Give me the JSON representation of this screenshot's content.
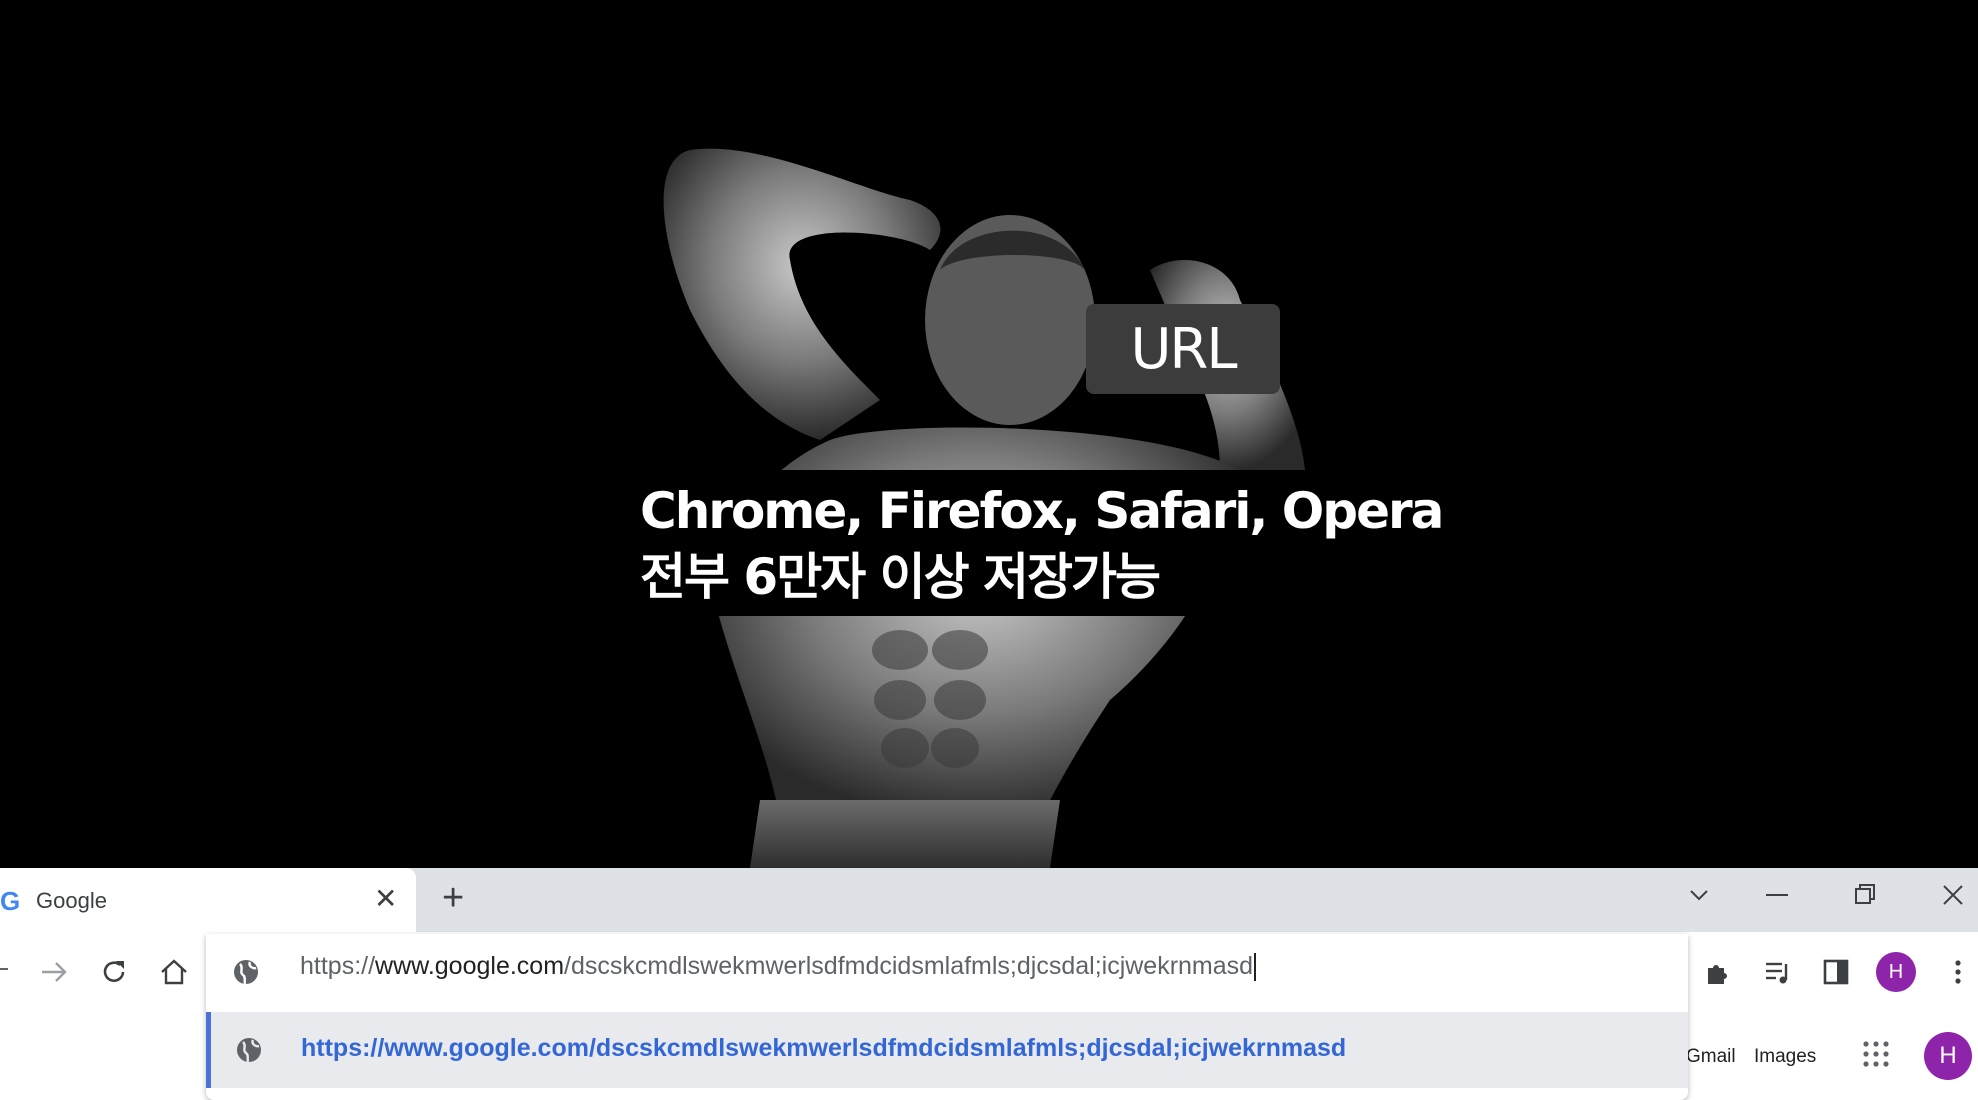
{
  "overlay": {
    "tag": "URL",
    "caption_lines": [
      "Chrome, Firefox, Safari, Opera",
      "전부 6만자 이상 저장가능"
    ]
  },
  "tabstrip": {
    "tab_title": "Google",
    "favicon": "G",
    "close_glyph": "✕",
    "new_tab_glyph": "+"
  },
  "omnibox": {
    "url_scheme": "https://",
    "url_host": "www.google.com",
    "url_path": "/dscskcmdlswekmwerlsdfmdcidsmlafmls;djcsdal;icjwekrnmasd",
    "suggestion": "https://www.google.com/dscskcmdlswekmwerlsdfmdcidsmlafmls;djcsdal;icjwekrnmasd"
  },
  "toolbar": {
    "avatar_initial": "H"
  },
  "page": {
    "gmail_label": "Gmail",
    "images_label": "Images",
    "avatar_initial": "H"
  },
  "icons": [
    "back-icon",
    "forward-icon",
    "reload-icon",
    "home-icon",
    "globe-icon",
    "extensions-icon",
    "media-control-icon",
    "side-panel-icon",
    "menu-icon",
    "apps-grid-icon",
    "tab-search-icon",
    "minimize-icon",
    "restore-icon",
    "close-window-icon"
  ]
}
